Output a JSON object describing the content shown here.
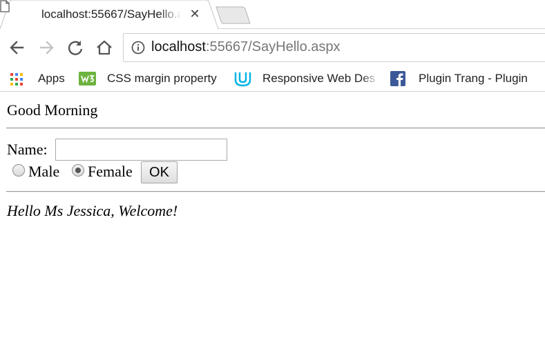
{
  "browser": {
    "tab": {
      "title": "localhost:55667/SayHello.aspx",
      "close_glyph": "✕",
      "favicon_icon": "page-icon"
    },
    "toolbar": {
      "back_icon": "back-arrow-icon",
      "forward_icon": "forward-arrow-icon",
      "reload_icon": "reload-icon",
      "home_icon": "home-icon"
    },
    "omnibox": {
      "info_icon": "info-icon",
      "url_host": "localhost",
      "url_rest": ":55667/SayHello.aspx"
    },
    "bookmarks": [
      {
        "label": "Apps",
        "icon": "apps-grid-icon"
      },
      {
        "label": "CSS margin property",
        "icon": "w3schools-icon"
      },
      {
        "label": "Responsive Web Des",
        "icon": "udacity-icon"
      },
      {
        "label": "Plugin Trang - Plugin",
        "icon": "facebook-icon"
      }
    ]
  },
  "page": {
    "greeting": "Good Morning",
    "name_label": "Name:",
    "name_value": "",
    "gender_options": [
      {
        "label": "Male",
        "checked": false
      },
      {
        "label": "Female",
        "checked": true
      }
    ],
    "ok_label": "OK",
    "result_message": "Hello Ms Jessica, Welcome!"
  }
}
